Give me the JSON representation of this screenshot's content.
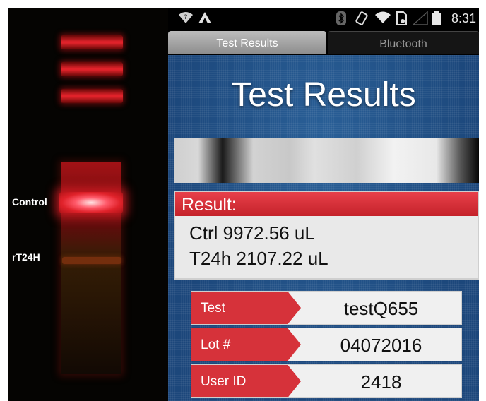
{
  "gel": {
    "labels": {
      "control": "Control",
      "rt24h": "rT24H"
    }
  },
  "status_bar": {
    "time": "8:31",
    "icons": [
      "wifi-question-icon",
      "notification-a-icon",
      "bluetooth-icon",
      "rotate-icon",
      "wifi-icon",
      "sim-icon",
      "signal-icon",
      "battery-icon"
    ]
  },
  "tabs": [
    {
      "label": "Test Results",
      "active": true
    },
    {
      "label": "Bluetooth",
      "active": false
    }
  ],
  "page": {
    "title": "Test Results"
  },
  "result": {
    "header": "Result:",
    "lines": [
      "Ctrl 9972.56 uL",
      "T24h 2107.22 uL"
    ]
  },
  "info": [
    {
      "label": "Test",
      "value": "testQ655"
    },
    {
      "label": "Lot #",
      "value": "04072016"
    },
    {
      "label": "User ID",
      "value": "2418"
    }
  ],
  "colors": {
    "accent_red": "#d6323a",
    "background_blue": "#1f4f86",
    "band_red": "#e0222a"
  }
}
